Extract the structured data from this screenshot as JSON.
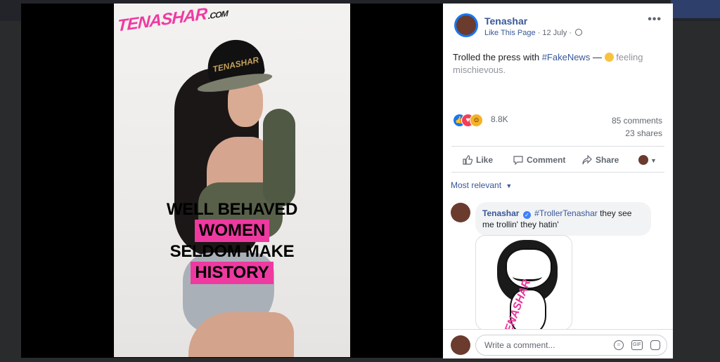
{
  "photo": {
    "logo_main": "TENASHAR",
    "logo_suffix": ".COM",
    "cap_text": "TENASHAR",
    "slogan": [
      "WELL BEHAVED",
      "WOMEN",
      "SELDOM MAKE",
      "HISTORY"
    ]
  },
  "post": {
    "page_name": "Tenashar",
    "like_link": "Like This Page",
    "date": "12 July",
    "text_prefix": "Trolled the press with ",
    "hashtag": "#FakeNews",
    "dash": " — ",
    "feeling": "feeling mischievous.",
    "reaction_count": "8.8K",
    "comments_count": "85 comments",
    "shares_count": "23 shares"
  },
  "actions": {
    "like": "Like",
    "comment": "Comment",
    "share": "Share"
  },
  "comments": {
    "sort_label": "Most relevant",
    "items": [
      {
        "author": "Tenashar",
        "tag": "#TrollerTenashar",
        "text": " they see me trollin' they hatin'",
        "image_label": "TENASHAR"
      }
    ],
    "input_placeholder": "Write a comment..."
  }
}
